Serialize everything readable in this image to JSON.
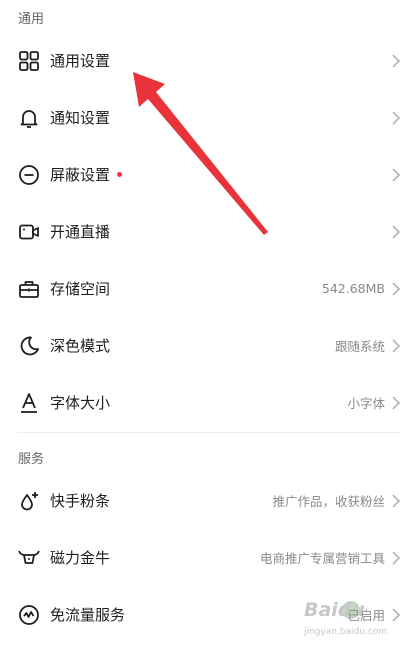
{
  "sections": {
    "general": {
      "title": "通用"
    },
    "services": {
      "title": "服务"
    }
  },
  "items": {
    "general_settings": {
      "label": "通用设置",
      "icon": "grid-icon"
    },
    "notification_settings": {
      "label": "通知设置",
      "icon": "bell-icon"
    },
    "block_settings": {
      "label": "屏蔽设置",
      "icon": "minus-circle-icon",
      "badge_color": "#fe2c55"
    },
    "start_live": {
      "label": "开通直播",
      "icon": "video-camera-icon"
    },
    "storage": {
      "label": "存储空间",
      "value": "542.68MB",
      "icon": "toolbox-icon"
    },
    "dark_mode": {
      "label": "深色模式",
      "value": "跟随系统",
      "icon": "moon-icon"
    },
    "font_size": {
      "label": "字体大小",
      "value": "小字体",
      "icon": "font-a-icon"
    },
    "kuaishou_fans": {
      "label": "快手粉条",
      "value": "推广作品，收获粉丝",
      "icon": "drop-plus-icon"
    },
    "magnetic_niu": {
      "label": "磁力金牛",
      "value": "电商推广专属营销工具",
      "icon": "bull-icon"
    },
    "free_data": {
      "label": "免流量服务",
      "value": "已启用",
      "icon": "pulse-circle-icon"
    }
  },
  "watermark": {
    "brand": "Baidu",
    "site": "jingyan.baidu.com"
  },
  "colors": {
    "accent_red": "#fe2c55",
    "arrow_red": "#e8333a",
    "text_primary": "#1f1f1f",
    "text_secondary": "#8a8a8a"
  }
}
